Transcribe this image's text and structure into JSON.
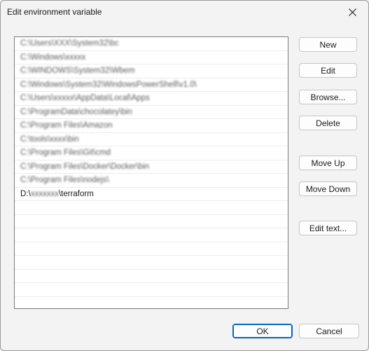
{
  "window": {
    "title": "Edit environment variable"
  },
  "list": {
    "rows": [
      {
        "text": "C:\\Users\\XXX\\System32\\bc",
        "blurred": true
      },
      {
        "text": "C:\\Windows\\xxxxx",
        "blurred": true
      },
      {
        "text": "C:\\WINDOWS\\System32\\Wbem",
        "blurred": true
      },
      {
        "text": "C:\\Windows\\System32\\WindowsPowerShell\\v1.0\\",
        "blurred": true
      },
      {
        "text": "C:\\Users\\xxxxx\\AppData\\Local\\Apps",
        "blurred": true
      },
      {
        "text": "C:\\ProgramData\\chocolatey\\bin",
        "blurred": true
      },
      {
        "text": "C:\\Program Files\\Amazon",
        "blurred": true
      },
      {
        "text": "C:\\tools\\xxxx\\bin",
        "blurred": true
      },
      {
        "text": "C:\\Program Files\\Git\\cmd",
        "blurred": true
      },
      {
        "text": "C:\\Program Files\\Docker\\Docker\\bin",
        "blurred": true
      },
      {
        "text": "C:\\Program Files\\nodejs\\",
        "blurred": true
      },
      {
        "text": "D:\\xxxxxxx\\terraform",
        "prefix": "D:\\",
        "blur_part": "xxxxxxx",
        "suffix": "\\terraform",
        "partial": true
      }
    ],
    "empty_rows": 9
  },
  "buttons": {
    "new": "New",
    "edit": "Edit",
    "browse": "Browse...",
    "delete": "Delete",
    "move_up": "Move Up",
    "move_down": "Move Down",
    "edit_text": "Edit text...",
    "ok": "OK",
    "cancel": "Cancel"
  },
  "icons": {
    "close": "close-icon"
  },
  "colors": {
    "accent": "#0067c0",
    "background": "#f3f3f3",
    "list_bg": "#ffffff"
  }
}
